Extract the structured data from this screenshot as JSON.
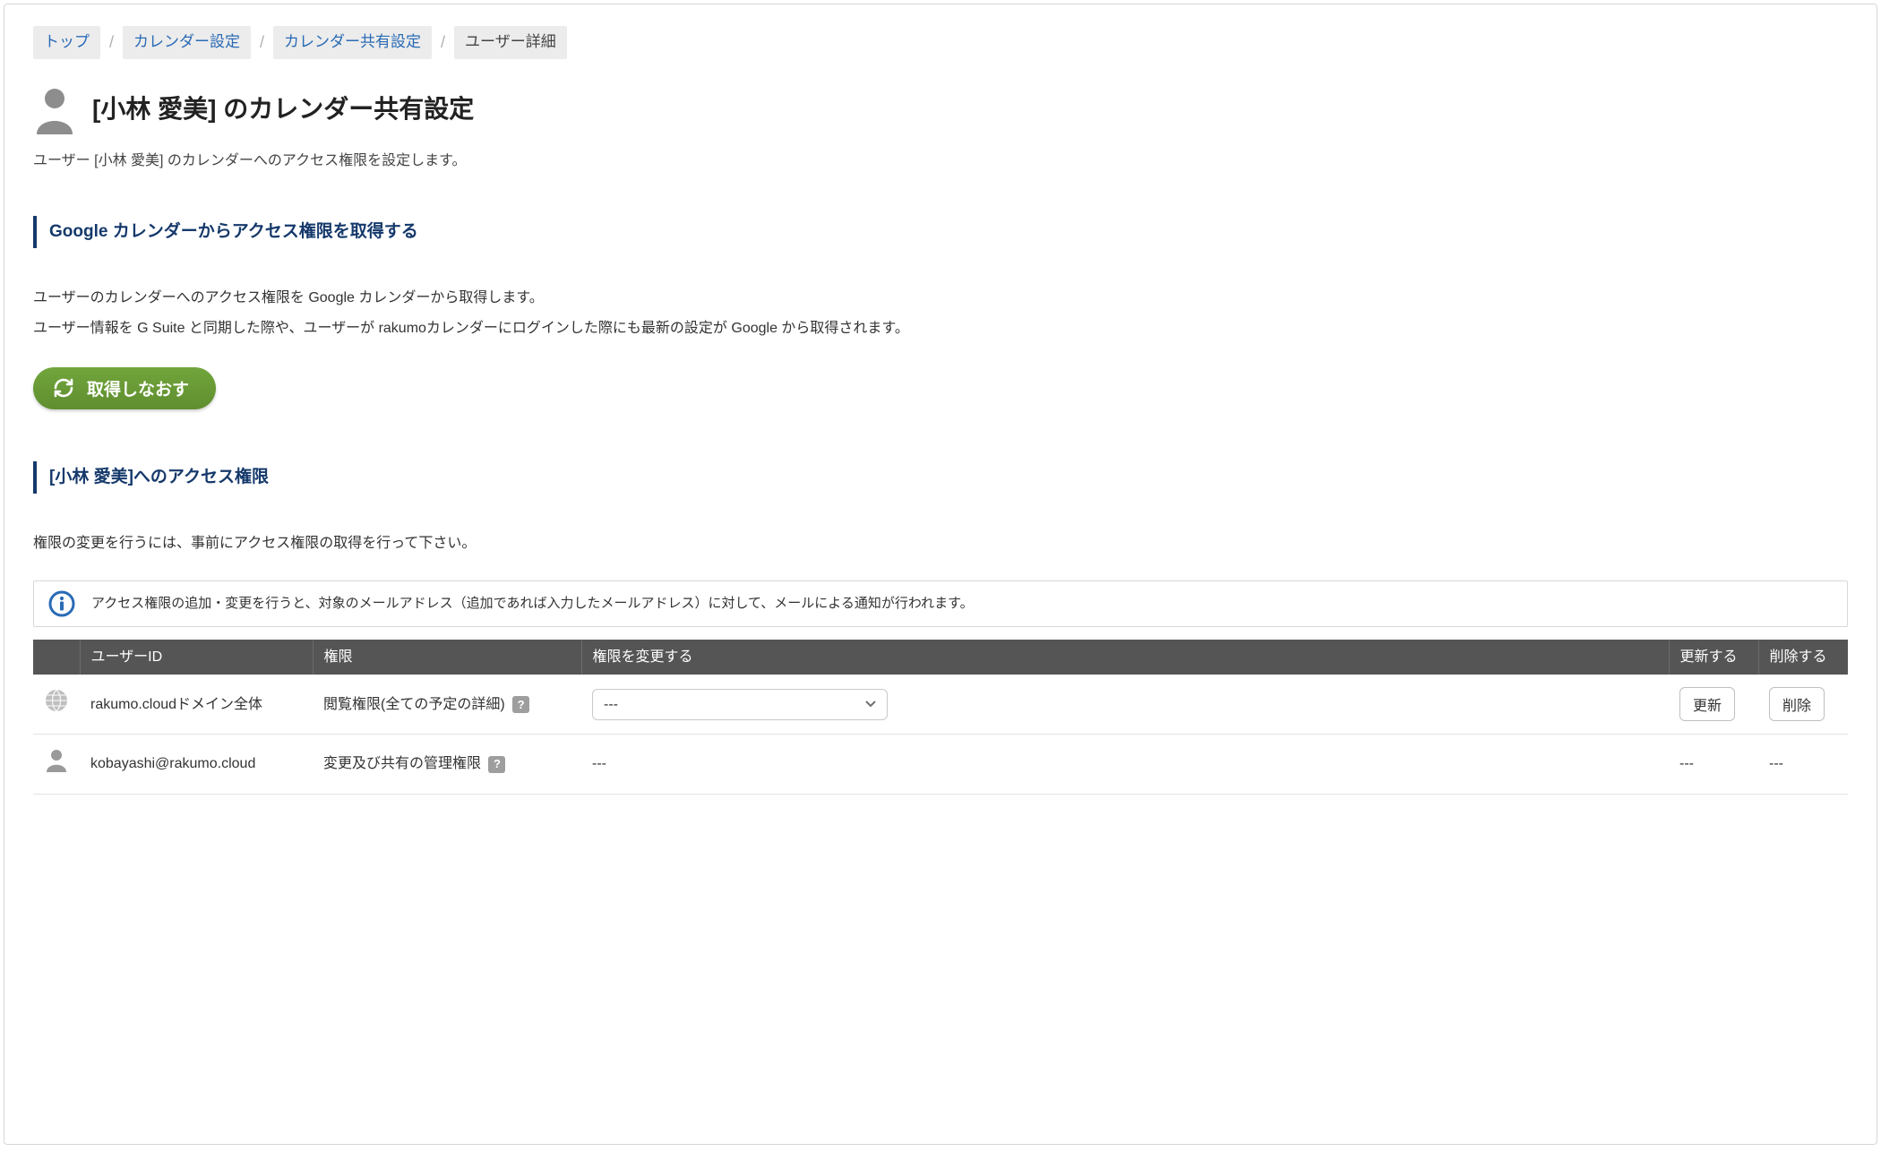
{
  "breadcrumb": {
    "items": [
      {
        "label": "トップ",
        "link": true
      },
      {
        "label": "カレンダー設定",
        "link": true
      },
      {
        "label": "カレンダー共有設定",
        "link": true
      },
      {
        "label": "ユーザー詳細",
        "link": false
      }
    ]
  },
  "page": {
    "title": "[小林 愛美] のカレンダー共有設定",
    "subtitle": "ユーザー [小林 愛美] のカレンダーへのアクセス権限を設定します。"
  },
  "section_fetch": {
    "heading": "Google カレンダーからアクセス権限を取得する",
    "desc1": "ユーザーのカレンダーへのアクセス権限を Google カレンダーから取得します。",
    "desc2": "ユーザー情報を G Suite と同期した際や、ユーザーが rakumoカレンダーにログインした際にも最新の設定が Google から取得されます。",
    "button": "取得しなおす"
  },
  "section_access": {
    "heading": "[小林 愛美]へのアクセス権限",
    "desc": "権限の変更を行うには、事前にアクセス権限の取得を行って下さい。",
    "info": "アクセス権限の追加・変更を行うと、対象のメールアドレス（追加であれば入力したメールアドレス）に対して、メールによる通知が行われます。"
  },
  "table": {
    "columns": {
      "user_id": "ユーザーID",
      "perm": "権限",
      "change": "権限を変更する",
      "update": "更新する",
      "delete": "削除する"
    },
    "select_default": "---",
    "rows": [
      {
        "icon": "globe",
        "user_id": "rakumo.cloudドメイン全体",
        "perm": "閲覧権限(全ての予定の詳細)",
        "has_select": true,
        "update_label": "更新",
        "delete_label": "削除"
      },
      {
        "icon": "person",
        "user_id": "kobayashi@rakumo.cloud",
        "perm": "変更及び共有の管理権限",
        "has_select": false,
        "change_text": "---",
        "update_text": "---",
        "delete_text": "---"
      }
    ]
  }
}
